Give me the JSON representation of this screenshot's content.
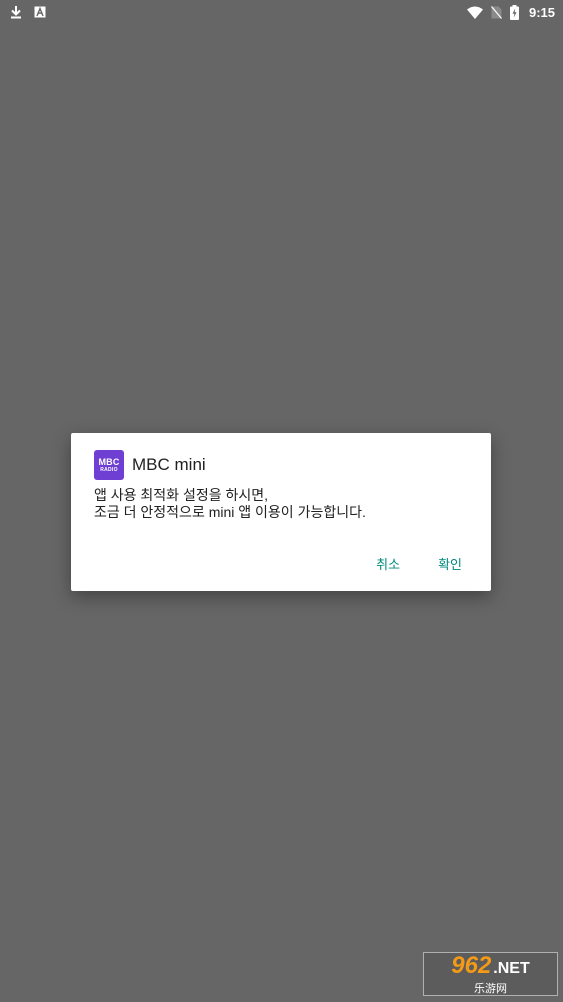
{
  "status_bar": {
    "left_icons": [
      "download-icon",
      "keyboard-icon"
    ],
    "right_icons": [
      "wifi-icon",
      "no-sim-icon",
      "battery-charging-icon"
    ],
    "time": "9:15"
  },
  "dialog": {
    "app_logo": {
      "main": "MBC",
      "sub": "RADIO"
    },
    "title": "MBC mini",
    "message_line1": "앱 사용 최적화 설정을 하시면,",
    "message_line2": "조금 더 안정적으로 mini 앱 이용이 가능합니다.",
    "cancel_label": "취소",
    "confirm_label": "확인"
  },
  "watermark": {
    "number": "962",
    "suffix": ".NET",
    "chinese": "乐游网"
  },
  "colors": {
    "scrim": "#666666",
    "accent": "#00897b",
    "logo": "#6f3fd4"
  }
}
